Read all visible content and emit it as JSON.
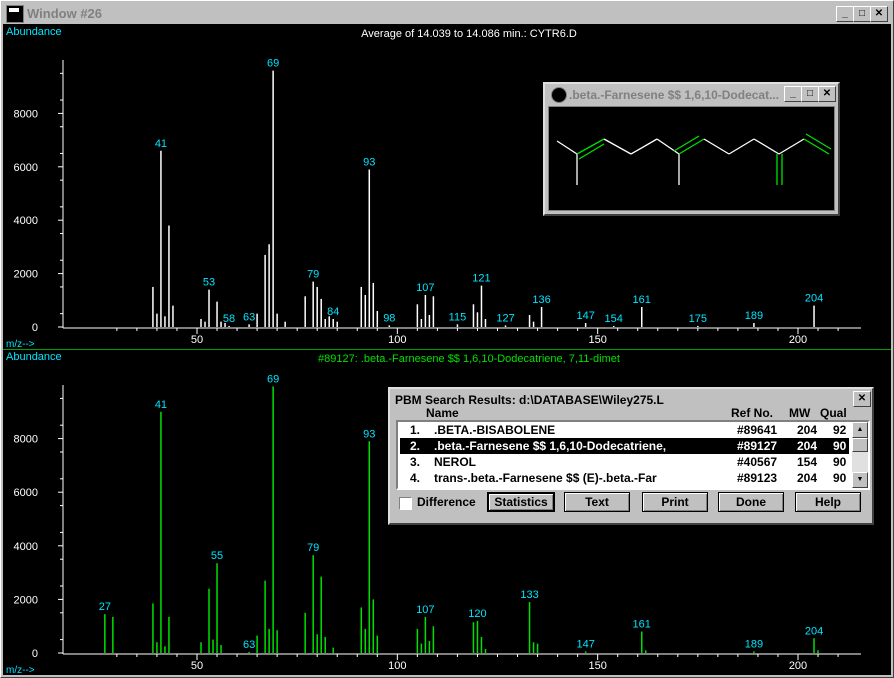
{
  "window": {
    "title": "Window #26"
  },
  "top_plot": {
    "title": "Average of 14.039 to 14.086 min.: CYTR6.D",
    "ylabel": "Abundance",
    "xlabel": "m/z-->",
    "color": "#ffffff",
    "label_color": "#00e5ff",
    "yticks": [
      "0",
      "2000",
      "4000",
      "6000",
      "8000"
    ],
    "xticks": [
      "50",
      "100",
      "150",
      "200"
    ],
    "peaks": [
      {
        "mz": 41,
        "ab": 6600,
        "label": "41"
      },
      {
        "mz": 43,
        "ab": 3800
      },
      {
        "mz": 39,
        "ab": 1500
      },
      {
        "mz": 40,
        "ab": 500
      },
      {
        "mz": 42,
        "ab": 400
      },
      {
        "mz": 44,
        "ab": 800
      },
      {
        "mz": 51,
        "ab": 300
      },
      {
        "mz": 52,
        "ab": 200
      },
      {
        "mz": 53,
        "ab": 1400,
        "label": "53"
      },
      {
        "mz": 55,
        "ab": 950
      },
      {
        "mz": 56,
        "ab": 200
      },
      {
        "mz": 57,
        "ab": 150
      },
      {
        "mz": 58,
        "ab": 40,
        "label": "58"
      },
      {
        "mz": 63,
        "ab": 100,
        "label": "63"
      },
      {
        "mz": 65,
        "ab": 500
      },
      {
        "mz": 67,
        "ab": 2700
      },
      {
        "mz": 68,
        "ab": 3100
      },
      {
        "mz": 69,
        "ab": 9600,
        "label": "69"
      },
      {
        "mz": 70,
        "ab": 500
      },
      {
        "mz": 72,
        "ab": 200
      },
      {
        "mz": 77,
        "ab": 1150
      },
      {
        "mz": 79,
        "ab": 1700,
        "label": "79"
      },
      {
        "mz": 80,
        "ab": 1500
      },
      {
        "mz": 81,
        "ab": 1050
      },
      {
        "mz": 82,
        "ab": 300
      },
      {
        "mz": 83,
        "ab": 400
      },
      {
        "mz": 84,
        "ab": 300,
        "label": "84"
      },
      {
        "mz": 85,
        "ab": 200
      },
      {
        "mz": 91,
        "ab": 1500
      },
      {
        "mz": 92,
        "ab": 1200
      },
      {
        "mz": 93,
        "ab": 5900,
        "label": "93"
      },
      {
        "mz": 94,
        "ab": 1650
      },
      {
        "mz": 95,
        "ab": 600
      },
      {
        "mz": 98,
        "ab": 60,
        "label": "98"
      },
      {
        "mz": 105,
        "ab": 850
      },
      {
        "mz": 106,
        "ab": 300
      },
      {
        "mz": 107,
        "ab": 1200,
        "label": "107"
      },
      {
        "mz": 108,
        "ab": 450
      },
      {
        "mz": 109,
        "ab": 1150
      },
      {
        "mz": 115,
        "ab": 100,
        "label": "115"
      },
      {
        "mz": 119,
        "ab": 850
      },
      {
        "mz": 120,
        "ab": 550
      },
      {
        "mz": 121,
        "ab": 1550,
        "label": "121"
      },
      {
        "mz": 122,
        "ab": 300
      },
      {
        "mz": 127,
        "ab": 60,
        "label": "127"
      },
      {
        "mz": 133,
        "ab": 450
      },
      {
        "mz": 134,
        "ab": 200
      },
      {
        "mz": 136,
        "ab": 750,
        "label": "136"
      },
      {
        "mz": 147,
        "ab": 150,
        "label": "147"
      },
      {
        "mz": 154,
        "ab": 40,
        "label": "154"
      },
      {
        "mz": 161,
        "ab": 750,
        "label": "161"
      },
      {
        "mz": 175,
        "ab": 40,
        "label": "175"
      },
      {
        "mz": 189,
        "ab": 150,
        "label": "189"
      },
      {
        "mz": 204,
        "ab": 800,
        "label": "204"
      }
    ]
  },
  "bottom_plot": {
    "title": "#89127: .beta.-Farnesene $$ 1,6,10-Dodecatriene, 7,11-dimet",
    "ylabel": "Abundance",
    "xlabel": "m/z-->",
    "color": "#00e000",
    "label_color": "#00e5ff",
    "yticks": [
      "0",
      "2000",
      "4000",
      "6000",
      "8000"
    ],
    "xticks": [
      "50",
      "100",
      "150",
      "200"
    ],
    "peaks": [
      {
        "mz": 27,
        "ab": 1450,
        "label": "27"
      },
      {
        "mz": 29,
        "ab": 1350
      },
      {
        "mz": 39,
        "ab": 1850
      },
      {
        "mz": 40,
        "ab": 400
      },
      {
        "mz": 41,
        "ab": 9000,
        "label": "41"
      },
      {
        "mz": 42,
        "ab": 250
      },
      {
        "mz": 43,
        "ab": 1350
      },
      {
        "mz": 51,
        "ab": 400
      },
      {
        "mz": 53,
        "ab": 2400
      },
      {
        "mz": 54,
        "ab": 500
      },
      {
        "mz": 55,
        "ab": 3350,
        "label": "55"
      },
      {
        "mz": 56,
        "ab": 300
      },
      {
        "mz": 63,
        "ab": 40,
        "label": "63"
      },
      {
        "mz": 65,
        "ab": 650
      },
      {
        "mz": 67,
        "ab": 2700
      },
      {
        "mz": 68,
        "ab": 900
      },
      {
        "mz": 69,
        "ab": 9950,
        "label": "69"
      },
      {
        "mz": 70,
        "ab": 850
      },
      {
        "mz": 77,
        "ab": 1500
      },
      {
        "mz": 79,
        "ab": 3650,
        "label": "79"
      },
      {
        "mz": 80,
        "ab": 700
      },
      {
        "mz": 81,
        "ab": 2850
      },
      {
        "mz": 82,
        "ab": 600
      },
      {
        "mz": 84,
        "ab": 200
      },
      {
        "mz": 91,
        "ab": 1700
      },
      {
        "mz": 92,
        "ab": 900
      },
      {
        "mz": 93,
        "ab": 7900,
        "label": "93"
      },
      {
        "mz": 94,
        "ab": 2000
      },
      {
        "mz": 95,
        "ab": 650
      },
      {
        "mz": 105,
        "ab": 900
      },
      {
        "mz": 106,
        "ab": 350
      },
      {
        "mz": 107,
        "ab": 1350,
        "label": "107"
      },
      {
        "mz": 108,
        "ab": 450
      },
      {
        "mz": 109,
        "ab": 1000
      },
      {
        "mz": 119,
        "ab": 1150
      },
      {
        "mz": 120,
        "ab": 1200,
        "label": "120"
      },
      {
        "mz": 121,
        "ab": 600
      },
      {
        "mz": 122,
        "ab": 150
      },
      {
        "mz": 133,
        "ab": 1900,
        "label": "133"
      },
      {
        "mz": 134,
        "ab": 400
      },
      {
        "mz": 135,
        "ab": 350
      },
      {
        "mz": 147,
        "ab": 60,
        "label": "147"
      },
      {
        "mz": 161,
        "ab": 800,
        "label": "161"
      },
      {
        "mz": 162,
        "ab": 100
      },
      {
        "mz": 189,
        "ab": 60,
        "label": "189"
      },
      {
        "mz": 204,
        "ab": 550,
        "label": "204"
      },
      {
        "mz": 205,
        "ab": 100
      }
    ]
  },
  "structure_window": {
    "title": ".beta.-Farnesene $$ 1,6,10-Dodecat..."
  },
  "pbm": {
    "title": "PBM Search Results: d:\\DATABASE\\Wiley275.L",
    "headers": {
      "name": "Name",
      "ref": "Ref No.",
      "mw": "MW",
      "qual": "Qual"
    },
    "rows": [
      {
        "num": "1.",
        "name": ".BETA.-BISABOLENE",
        "ref": "#89641",
        "mw": "204",
        "qual": "92"
      },
      {
        "num": "2.",
        "name": ".beta.-Farnesene $$ 1,6,10-Dodecatriene,",
        "ref": "#89127",
        "mw": "204",
        "qual": "90"
      },
      {
        "num": "3.",
        "name": "NEROL",
        "ref": "#40567",
        "mw": "154",
        "qual": "90"
      },
      {
        "num": "4.",
        "name": "trans-.beta.-Farnesene $$ (E)-.beta.-Far",
        "ref": "#89123",
        "mw": "204",
        "qual": "90"
      }
    ],
    "selected_row": 1,
    "difference_label": "Difference",
    "buttons": {
      "statistics": "Statistics",
      "text": "Text",
      "print": "Print",
      "done": "Done",
      "help": "Help"
    }
  }
}
